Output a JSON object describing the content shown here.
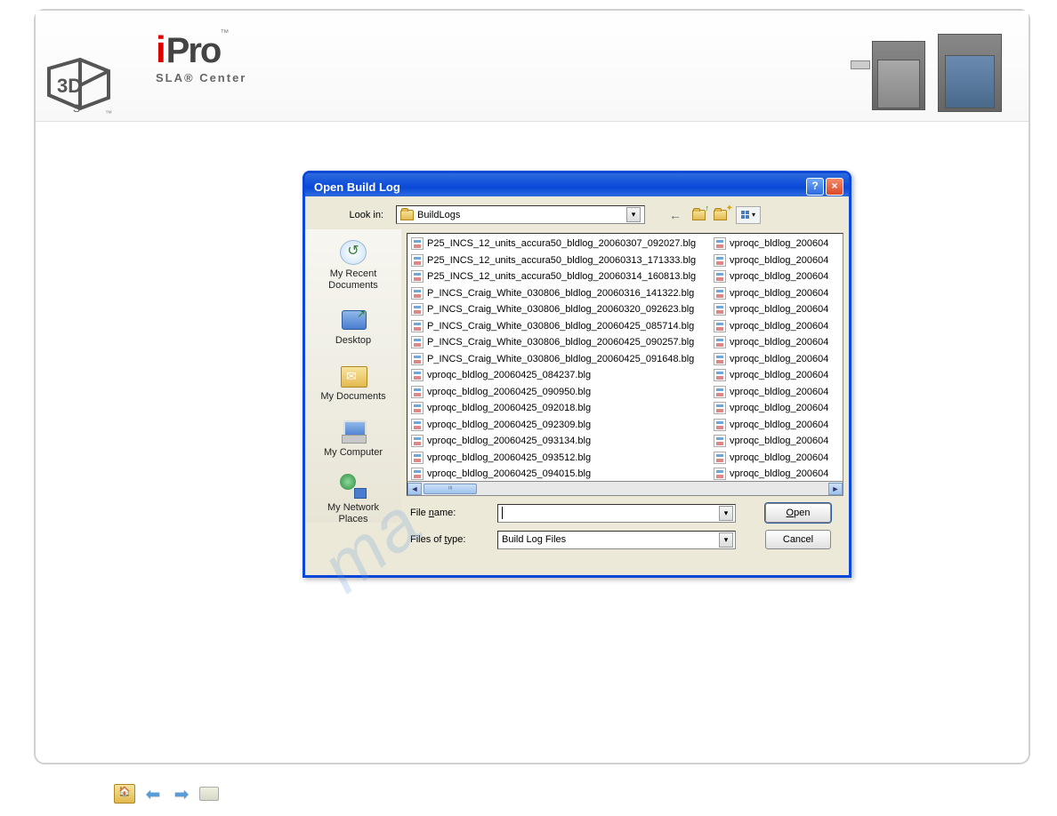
{
  "header": {
    "logo_ipro_top": "Pro",
    "logo_ipro_sub": "SLA® Center",
    "trademark": "™"
  },
  "dialog": {
    "title": "Open Build Log",
    "look_in_label": "Look in:",
    "look_in_value": "BuildLogs",
    "sidebar": [
      {
        "label": "My Recent Documents",
        "icon": "recent"
      },
      {
        "label": "Desktop",
        "icon": "desktop"
      },
      {
        "label": "My Documents",
        "icon": "docs"
      },
      {
        "label": "My Computer",
        "icon": "computer"
      },
      {
        "label": "My Network Places",
        "icon": "network"
      }
    ],
    "files_col1": [
      "P25_INCS_12_units_accura50_bldlog_20060307_092027.blg",
      "P25_INCS_12_units_accura50_bldlog_20060313_171333.blg",
      "P25_INCS_12_units_accura50_bldlog_20060314_160813.blg",
      "P_INCS_Craig_White_030806_bldlog_20060316_141322.blg",
      "P_INCS_Craig_White_030806_bldlog_20060320_092623.blg",
      "P_INCS_Craig_White_030806_bldlog_20060425_085714.blg",
      "P_INCS_Craig_White_030806_bldlog_20060425_090257.blg",
      "P_INCS_Craig_White_030806_bldlog_20060425_091648.blg",
      "vproqc_bldlog_20060425_084237.blg",
      "vproqc_bldlog_20060425_090950.blg",
      "vproqc_bldlog_20060425_092018.blg",
      "vproqc_bldlog_20060425_092309.blg",
      "vproqc_bldlog_20060425_093134.blg",
      "vproqc_bldlog_20060425_093512.blg",
      "vproqc_bldlog_20060425_094015.blg"
    ],
    "files_col2": [
      "vproqc_bldlog_200604",
      "vproqc_bldlog_200604",
      "vproqc_bldlog_200604",
      "vproqc_bldlog_200604",
      "vproqc_bldlog_200604",
      "vproqc_bldlog_200604",
      "vproqc_bldlog_200604",
      "vproqc_bldlog_200604",
      "vproqc_bldlog_200604",
      "vproqc_bldlog_200604",
      "vproqc_bldlog_200604",
      "vproqc_bldlog_200604",
      "vproqc_bldlog_200604",
      "vproqc_bldlog_200604",
      "vproqc_bldlog_200604"
    ],
    "file_name_label": "File name:",
    "file_name_value": "",
    "file_type_label": "Files of type:",
    "file_type_value": "Build Log Files",
    "open_label": "Open",
    "cancel_label": "Cancel"
  }
}
